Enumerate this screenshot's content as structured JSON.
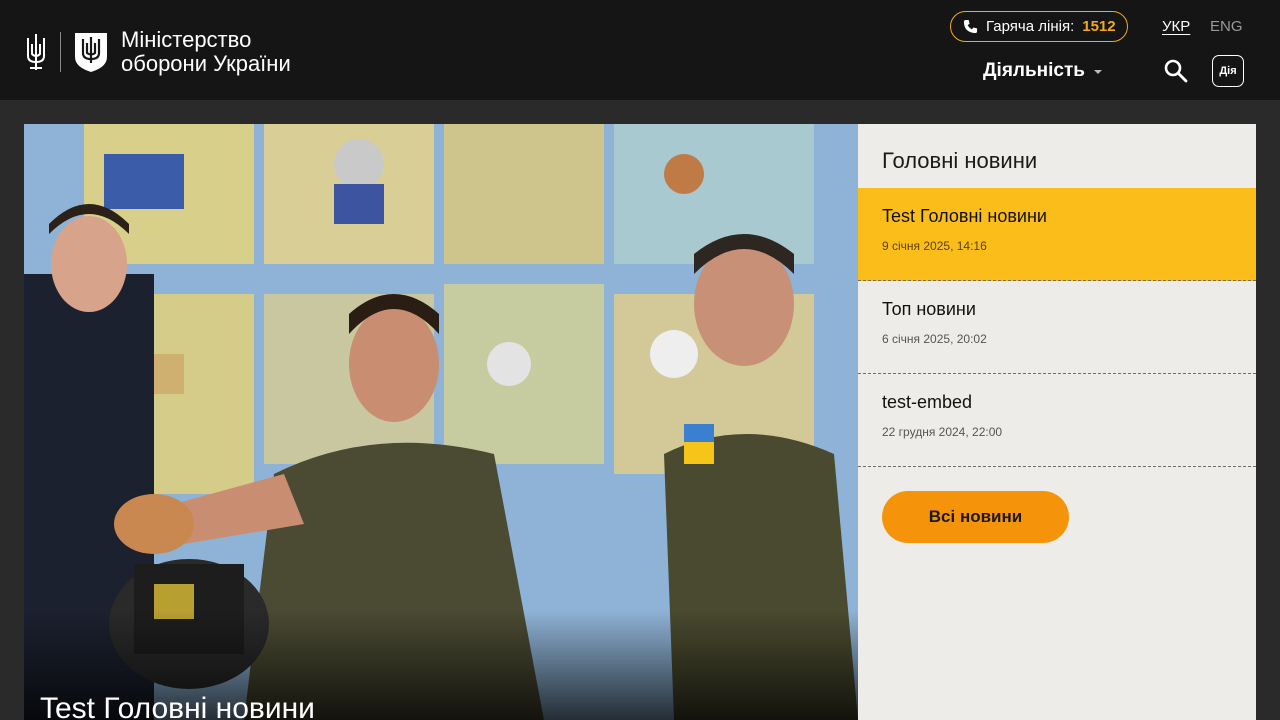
{
  "brand": {
    "line1": "Міністерство",
    "line2": "оборони України"
  },
  "hotline": {
    "label": "Гаряча лінія:",
    "number": "1512"
  },
  "lang": {
    "ukr": "УКР",
    "eng": "ENG"
  },
  "nav": {
    "activity": "Діяльність"
  },
  "diia": {
    "label": "Дія"
  },
  "hero": {
    "title": "Test Головні новини"
  },
  "panel": {
    "title": "Головні новини",
    "items": [
      {
        "title": "Test Головні новини",
        "date": "9 січня 2025, 14:16",
        "active": true
      },
      {
        "title": "Топ новини",
        "date": "6 січня 2025, 20:02",
        "active": false
      },
      {
        "title": "test-embed",
        "date": "22 грудня 2024, 22:00",
        "active": false
      }
    ],
    "all_news": "Всі новини"
  },
  "colors": {
    "header_bg": "#151515",
    "accent_orange": "#f5930a",
    "active_yellow": "#fbbd1a",
    "panel_bg": "#edece8"
  },
  "icons": [
    "trident-icon",
    "shield-logo-icon",
    "phone-icon",
    "chevron-down-icon",
    "search-icon",
    "diia-icon"
  ]
}
